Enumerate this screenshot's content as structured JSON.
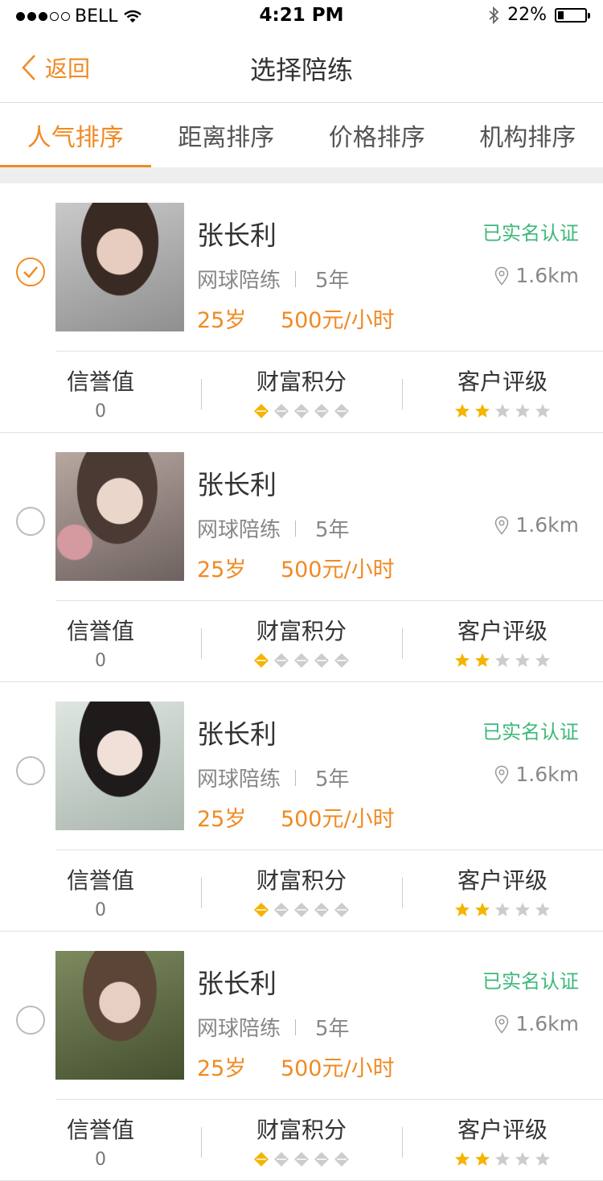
{
  "status_bar": {
    "carrier": "BELL",
    "time": "4:21 PM",
    "battery": "22%",
    "battery_level": 0.22,
    "signal_icon": "signal-dots-icon",
    "wifi_icon": "wifi-icon",
    "bluetooth_icon": "bluetooth-icon"
  },
  "nav": {
    "back_label": "返回",
    "title": "选择陪练"
  },
  "tabs": [
    {
      "label": "人气排序",
      "active": true
    },
    {
      "label": "距离排序",
      "active": false
    },
    {
      "label": "价格排序",
      "active": false
    },
    {
      "label": "机构排序",
      "active": false
    }
  ],
  "colors": {
    "accent": "#f08a24",
    "verified": "#3db87a",
    "star_on": "#f5b400",
    "star_off": "#cccccc"
  },
  "stat_labels": {
    "credit": "信誉值",
    "wealth": "财富积分",
    "rating": "客户评级"
  },
  "coaches": [
    {
      "selected": true,
      "name": "张长利",
      "verified_label": "已实名认证",
      "sport": "网球陪练",
      "years": "5年",
      "distance": "1.6km",
      "age": "25岁",
      "price": "500元/小时",
      "credit": "0",
      "wealth_points": 1,
      "wealth_max": 5,
      "rating_stars": 2,
      "rating_max": 5
    },
    {
      "selected": false,
      "name": "张长利",
      "verified_label": "",
      "sport": "网球陪练",
      "years": "5年",
      "distance": "1.6km",
      "age": "25岁",
      "price": "500元/小时",
      "credit": "0",
      "wealth_points": 1,
      "wealth_max": 5,
      "rating_stars": 2,
      "rating_max": 5
    },
    {
      "selected": false,
      "name": "张长利",
      "verified_label": "已实名认证",
      "sport": "网球陪练",
      "years": "5年",
      "distance": "1.6km",
      "age": "25岁",
      "price": "500元/小时",
      "credit": "0",
      "wealth_points": 1,
      "wealth_max": 5,
      "rating_stars": 2,
      "rating_max": 5
    },
    {
      "selected": false,
      "name": "张长利",
      "verified_label": "已实名认证",
      "sport": "网球陪练",
      "years": "5年",
      "distance": "1.6km",
      "age": "25岁",
      "price": "500元/小时",
      "credit": "0",
      "wealth_points": 1,
      "wealth_max": 5,
      "rating_stars": 2,
      "rating_max": 5
    }
  ]
}
